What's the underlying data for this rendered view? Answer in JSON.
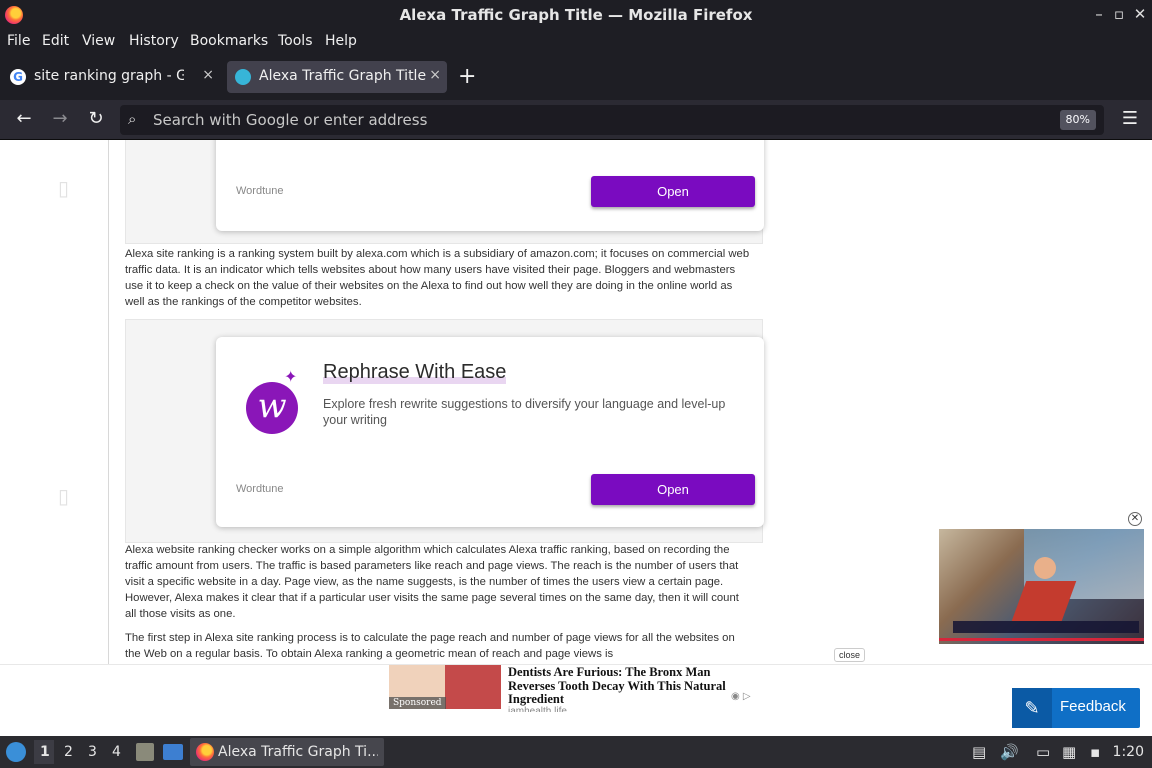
{
  "window": {
    "title": "Alexa Traffic Graph Title — Mozilla Firefox",
    "minimize": "–",
    "maximize": "▫",
    "close": "✕"
  },
  "menubar": {
    "items": [
      "File",
      "Edit",
      "View",
      "History",
      "Bookmarks",
      "Tools",
      "Help"
    ]
  },
  "tabs": [
    {
      "label": "site ranking graph - Goog",
      "favicon": "google-icon",
      "active": false
    },
    {
      "label": "Alexa Traffic Graph Title",
      "favicon": "site-icon",
      "active": true
    }
  ],
  "tab_close": "×",
  "new_tab": "+",
  "navbar": {
    "back": "←",
    "forward": "→",
    "reload": "↻",
    "search_icon": "🔍",
    "url_placeholder": "Search with Google or enter address",
    "zoom": "80%",
    "menu": "☰"
  },
  "page": {
    "ad_top": {
      "brand": "Wordtune",
      "button": "Open"
    },
    "paragraph_1": "Alexa site ranking is a ranking system built by alexa.com which is a subsidiary of amazon.com; it focuses on commercial web traffic data. It is an indicator which tells websites about how many users have visited their page. Bloggers and webmasters use it to keep a check on the value of their websites on the Alexa to find out how well they are doing in the online world as well as the rankings of the competitor websites.",
    "ad_main": {
      "logo_letter": "w",
      "headline": "Rephrase With Ease",
      "subtext": "Explore fresh rewrite suggestions to diversify your language and level-up your writing",
      "brand": "Wordtune",
      "button": "Open"
    },
    "paragraph_2": "Alexa website ranking checker works on a simple algorithm which calculates Alexa traffic ranking, based on recording the traffic amount from users. The traffic is based parameters like reach and page views. The reach is the number of users that visit a specific website in a day. Page view, as the name suggests, is the number of times the users view a certain page. However, Alexa makes it clear that if a particular user visits the same page several times on the same day, then it will count all those visits as one.",
    "paragraph_3": "The first step in Alexa site ranking process is to calculate the page reach and number of page views for all the websites on the Web on a regular basis. To obtain Alexa ranking a geometric mean of reach and page views is"
  },
  "video": {
    "close": "✕"
  },
  "bottom_ad": {
    "close": "close",
    "sponsored": "Sponsored",
    "headline": "Dentists Are Furious: The Bronx Man Reverses Tooth Decay With This Natural Ingredient",
    "source": "iamhealth.life",
    "adchoices": "◉ ▷"
  },
  "feedback": {
    "label": "Feedback",
    "icon": "feedback-icon"
  },
  "taskbar": {
    "workspaces": [
      "1",
      "2",
      "3",
      "4"
    ],
    "active_app": "Alexa Traffic Graph Ti...",
    "clock": "1:20"
  }
}
